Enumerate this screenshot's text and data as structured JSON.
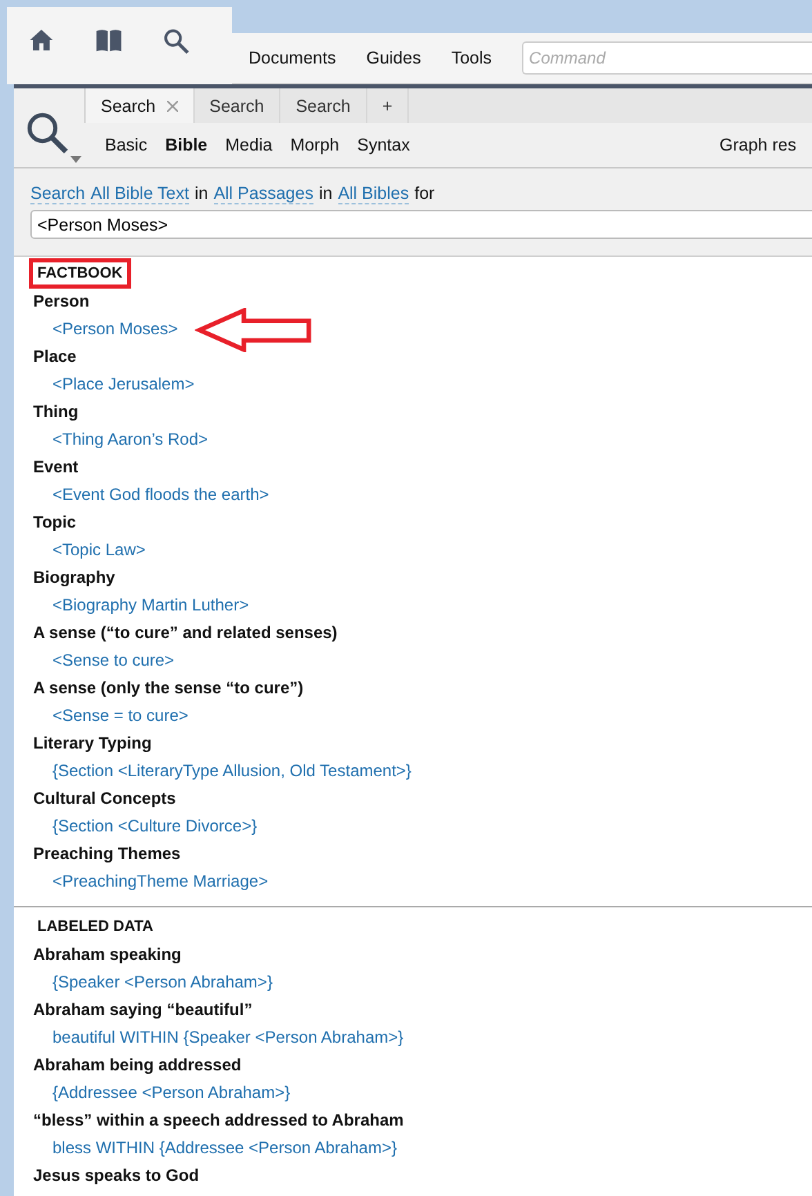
{
  "toolbar": {
    "menus": [
      "Documents",
      "Guides",
      "Tools"
    ],
    "command": {
      "placeholder": "Command"
    }
  },
  "tabs": [
    {
      "label": "Search",
      "selected": true,
      "closable": true
    },
    {
      "label": "Search",
      "selected": false,
      "closable": false
    },
    {
      "label": "Search",
      "selected": false,
      "closable": false
    },
    {
      "label": "+",
      "selected": false,
      "closable": false
    }
  ],
  "subtabs": [
    {
      "label": "Basic",
      "selected": false
    },
    {
      "label": "Bible",
      "selected": true
    },
    {
      "label": "Media",
      "selected": false
    },
    {
      "label": "Morph",
      "selected": false
    },
    {
      "label": "Syntax",
      "selected": false
    }
  ],
  "graph_results": "Graph res",
  "query_line": [
    {
      "kind": "link",
      "text": "Search"
    },
    {
      "kind": "link",
      "text": "All Bible Text"
    },
    {
      "kind": "text",
      "text": "in"
    },
    {
      "kind": "link",
      "text": "All Passages"
    },
    {
      "kind": "text",
      "text": "in"
    },
    {
      "kind": "link",
      "text": "All Bibles"
    },
    {
      "kind": "text",
      "text": "for"
    }
  ],
  "search_field": {
    "value": "<Person Moses>"
  },
  "sections": [
    {
      "title": "FACTBOOK",
      "highlighted": true,
      "items": [
        {
          "label": "Person",
          "query": "<Person Moses>",
          "pointed": true
        },
        {
          "label": "Place",
          "query": "<Place Jerusalem>",
          "pointed": false
        },
        {
          "label": "Thing",
          "query": "<Thing Aaron’s Rod>",
          "pointed": false
        },
        {
          "label": "Event",
          "query": "<Event God floods the earth>",
          "pointed": false
        },
        {
          "label": "Topic",
          "query": "<Topic Law>",
          "pointed": false
        },
        {
          "label": "Biography",
          "query": "<Biography Martin Luther>",
          "pointed": false
        },
        {
          "label": "A sense (“to cure” and related senses)",
          "query": "<Sense to cure>",
          "pointed": false
        },
        {
          "label": "A sense (only the sense “to cure”)",
          "query": "<Sense = to cure>",
          "pointed": false
        },
        {
          "label": "Literary Typing",
          "query": "{Section <LiteraryType Allusion, Old Testament>}",
          "pointed": false
        },
        {
          "label": "Cultural Concepts",
          "query": "{Section <Culture Divorce>}",
          "pointed": false
        },
        {
          "label": "Preaching Themes",
          "query": "<PreachingTheme Marriage>",
          "pointed": false
        }
      ]
    },
    {
      "title": "LABELED DATA",
      "highlighted": false,
      "items": [
        {
          "label": "Abraham speaking",
          "query": "{Speaker <Person Abraham>}",
          "pointed": false
        },
        {
          "label": "Abraham saying “beautiful”",
          "query": "beautiful WITHIN {Speaker <Person Abraham>}",
          "pointed": false
        },
        {
          "label": "Abraham being addressed",
          "query": "{Addressee <Person Abraham>}",
          "pointed": false
        },
        {
          "label": "“bless” within a speech addressed to Abraham",
          "query": "bless WITHIN {Addressee <Person Abraham>}",
          "pointed": false
        },
        {
          "label": "Jesus speaks to God"
        }
      ]
    }
  ]
}
